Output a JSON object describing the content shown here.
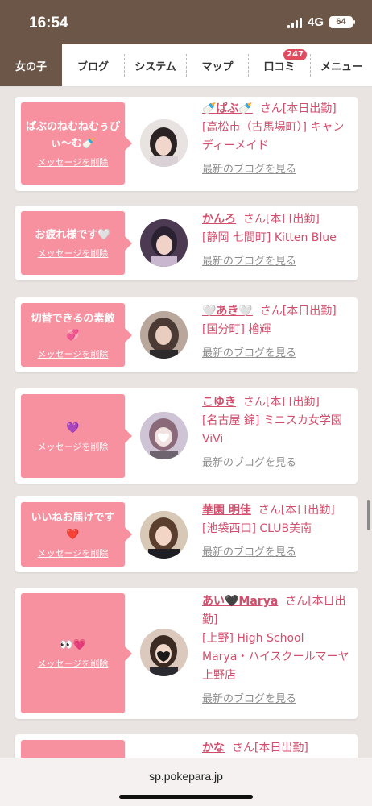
{
  "status": {
    "time": "16:54",
    "network": "4G",
    "battery": "64"
  },
  "nav": {
    "tabs": [
      {
        "label": "女の子",
        "active": true
      },
      {
        "label": "ブログ"
      },
      {
        "label": "システム"
      },
      {
        "label": "マップ"
      },
      {
        "label": "口コミ",
        "badge": "247"
      },
      {
        "label": "メニュー"
      }
    ]
  },
  "delete_label": "メッセージを削除",
  "blog_label": "最新のブログを見る",
  "entries": [
    {
      "message": "ぱぶのねむねむぅぴぃ～む🍼",
      "name": "🍼ぱぶ🍼",
      "suffix": "さん[本日出勤]",
      "shop": "[高松市（古馬場町）] キャンディーメイド"
    },
    {
      "message": "お疲れ様です🤍",
      "name": "かんろ",
      "suffix": "さん[本日出勤]",
      "shop": "[静岡 七間町] Kitten Blue"
    },
    {
      "message": "切替できるの素敵💞",
      "name": "🤍あき🤍",
      "suffix": "さん[本日出勤]",
      "shop": "[国分町] 檜輝"
    },
    {
      "message": "💜",
      "name": "こゆき",
      "suffix": "さん[本日出勤]",
      "shop": "[名古屋 錦] ミニスカ女学園ViVi"
    },
    {
      "message": "いいねお届けです❤️",
      "name": "華園 明佳",
      "suffix": "さん[本日出勤]",
      "shop": "[池袋西口] CLUB美南"
    },
    {
      "message": "👀💗",
      "name": "あい🖤Marya",
      "suffix": "さん[本日出勤]",
      "shop": "[上野] High School Marya・ハイスクールマーヤ上野店"
    },
    {
      "message": "",
      "name": "かな",
      "suffix": "さん[本日出勤]",
      "shop": ""
    }
  ],
  "url": "sp.pokepara.jp"
}
